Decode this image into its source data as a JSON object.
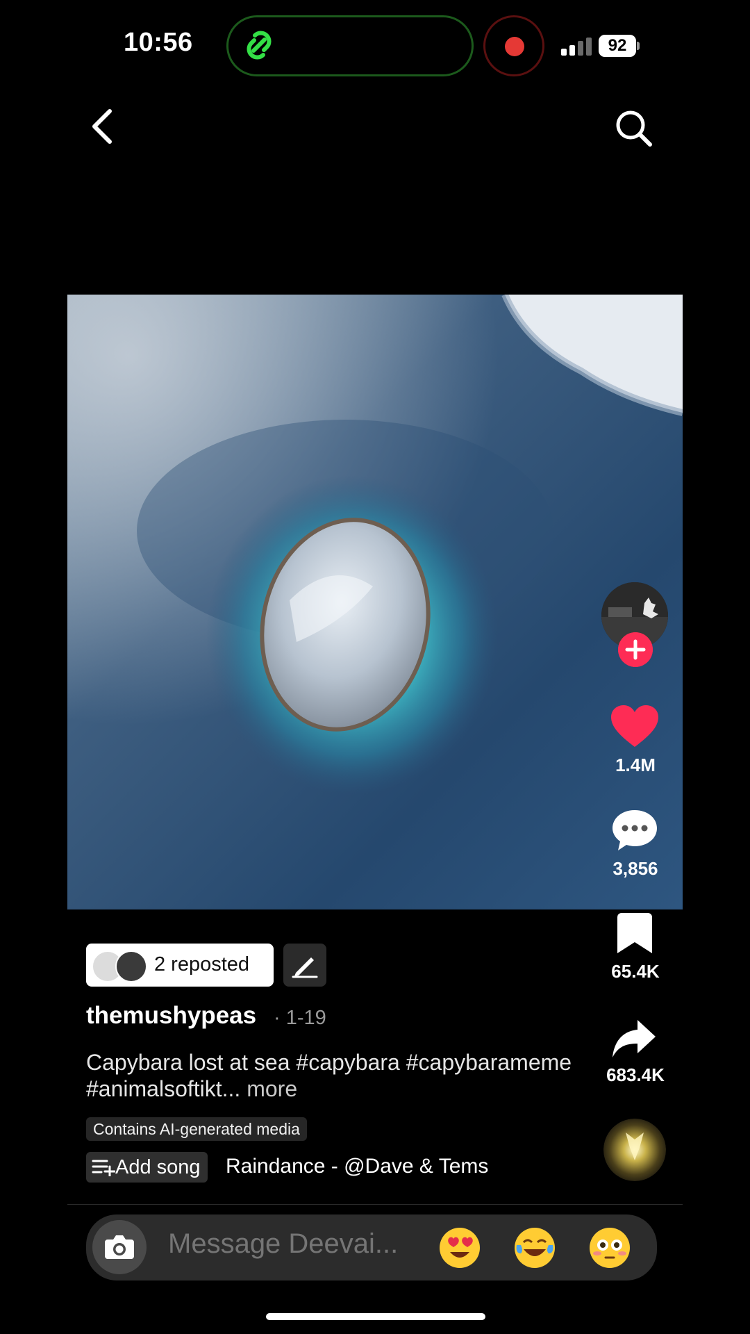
{
  "status": {
    "time": "10:56",
    "battery": "92"
  },
  "video": {
    "description": "aerial view of small island in ocean"
  },
  "rail": {
    "likes": "1.4M",
    "comments": "3,856",
    "saves": "65.4K",
    "shares": "683.4K"
  },
  "post": {
    "repost_label": "2 reposted",
    "username": "themushypeas",
    "date": "· 1-19",
    "caption": "Capybara lost at sea #capybara #capybarameme #animalsoftikt...",
    "more": "more",
    "ai_label": "Contains AI-generated media",
    "add_song": "Add song",
    "song": "Raindance - @Dave & Tems"
  },
  "message": {
    "placeholder": "Message Deevai..."
  },
  "colors": {
    "accent": "#fe2c55",
    "background": "#000000"
  }
}
